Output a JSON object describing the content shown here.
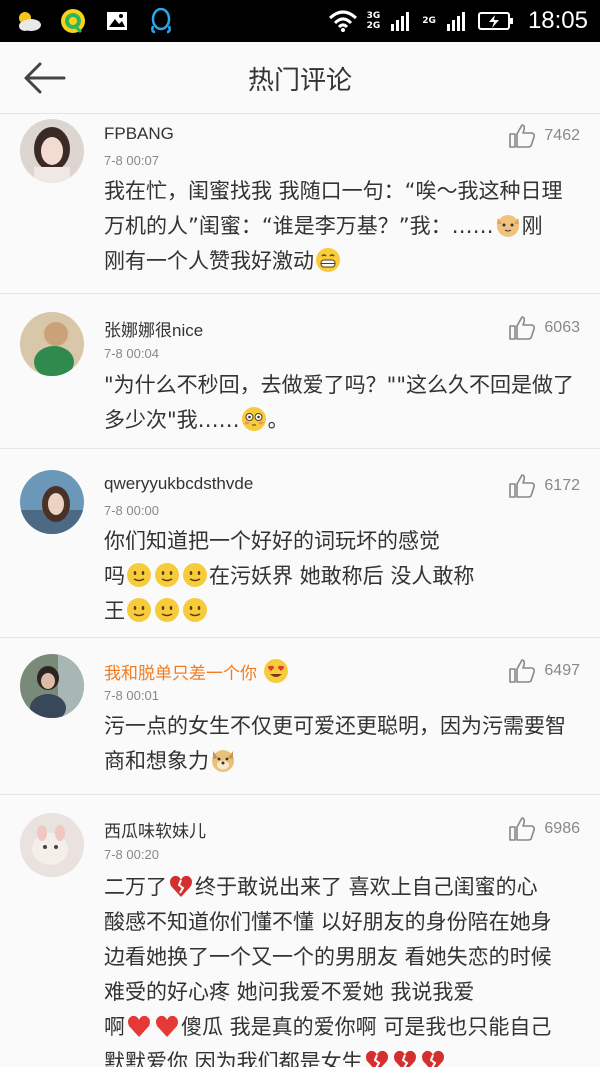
{
  "status_bar": {
    "time": "18:05",
    "net1": "3G",
    "net2": "2G",
    "net3": "2G",
    "icons": [
      "weather-icon",
      "music-app-icon",
      "gallery-icon",
      "qq-icon",
      "wifi-icon",
      "signal-icon",
      "battery-icon"
    ]
  },
  "header": {
    "title": "热门评论"
  },
  "comments": [
    {
      "user": "FPBANG",
      "time": "7-8 00:07",
      "likes": "7462",
      "line1": "我在忙，闺蜜找我  我随口一句：“唉～我这种日理",
      "line2a": "万机的人”闺蜜：“谁是李万基？”我：……",
      "line2b": "刚",
      "line3a": "刚有一个人赞我好激动"
    },
    {
      "user": "张娜娜很nice",
      "time": "7-8 00:04",
      "likes": "6063",
      "line1": "\"为什么不秒回，去做爱了吗？\"\"这么久不回是做了",
      "line2a": "多少次\"我……",
      "line2b": "。"
    },
    {
      "user": "qweryyukbcdsthvde",
      "time": "7-8 00:00",
      "likes": "6172",
      "line1": "你们知道把一个好好的词玩坏的感觉",
      "line2a": "吗",
      "line2b": "在污妖界  她敢称后  没人敢称",
      "line3a": "王"
    },
    {
      "user": "我和脱单只差一个你",
      "time": "7-8 00:01",
      "likes": "6497",
      "line1": "污一点的女生不仅更可爱还更聪明，因为污需要智",
      "line2a": "商和想象力"
    },
    {
      "user": "西瓜味软妹儿",
      "time": "7-8 00:20",
      "likes": "6986",
      "line1a": "二万了",
      "line1b": "终于敢说出来了   喜欢上自己闺蜜的心",
      "line2": "酸感不知道你们懂不懂   以好朋友的身份陪在她身",
      "line3": "边看她换了一个又一个的男朋友   看她失恋的时候",
      "line4": "难受的好心疼   她问我爱不爱她  我说我爱",
      "line5a": "啊",
      "line5b": "傻瓜  我是真的爱你啊   可是我也只能自己",
      "line6a": "默默爱你  因为我们都是女生"
    }
  ],
  "colors": {
    "vip_name": "#f47c20",
    "text": "#333333",
    "meta": "#888888",
    "divider": "#e6e6e6"
  }
}
